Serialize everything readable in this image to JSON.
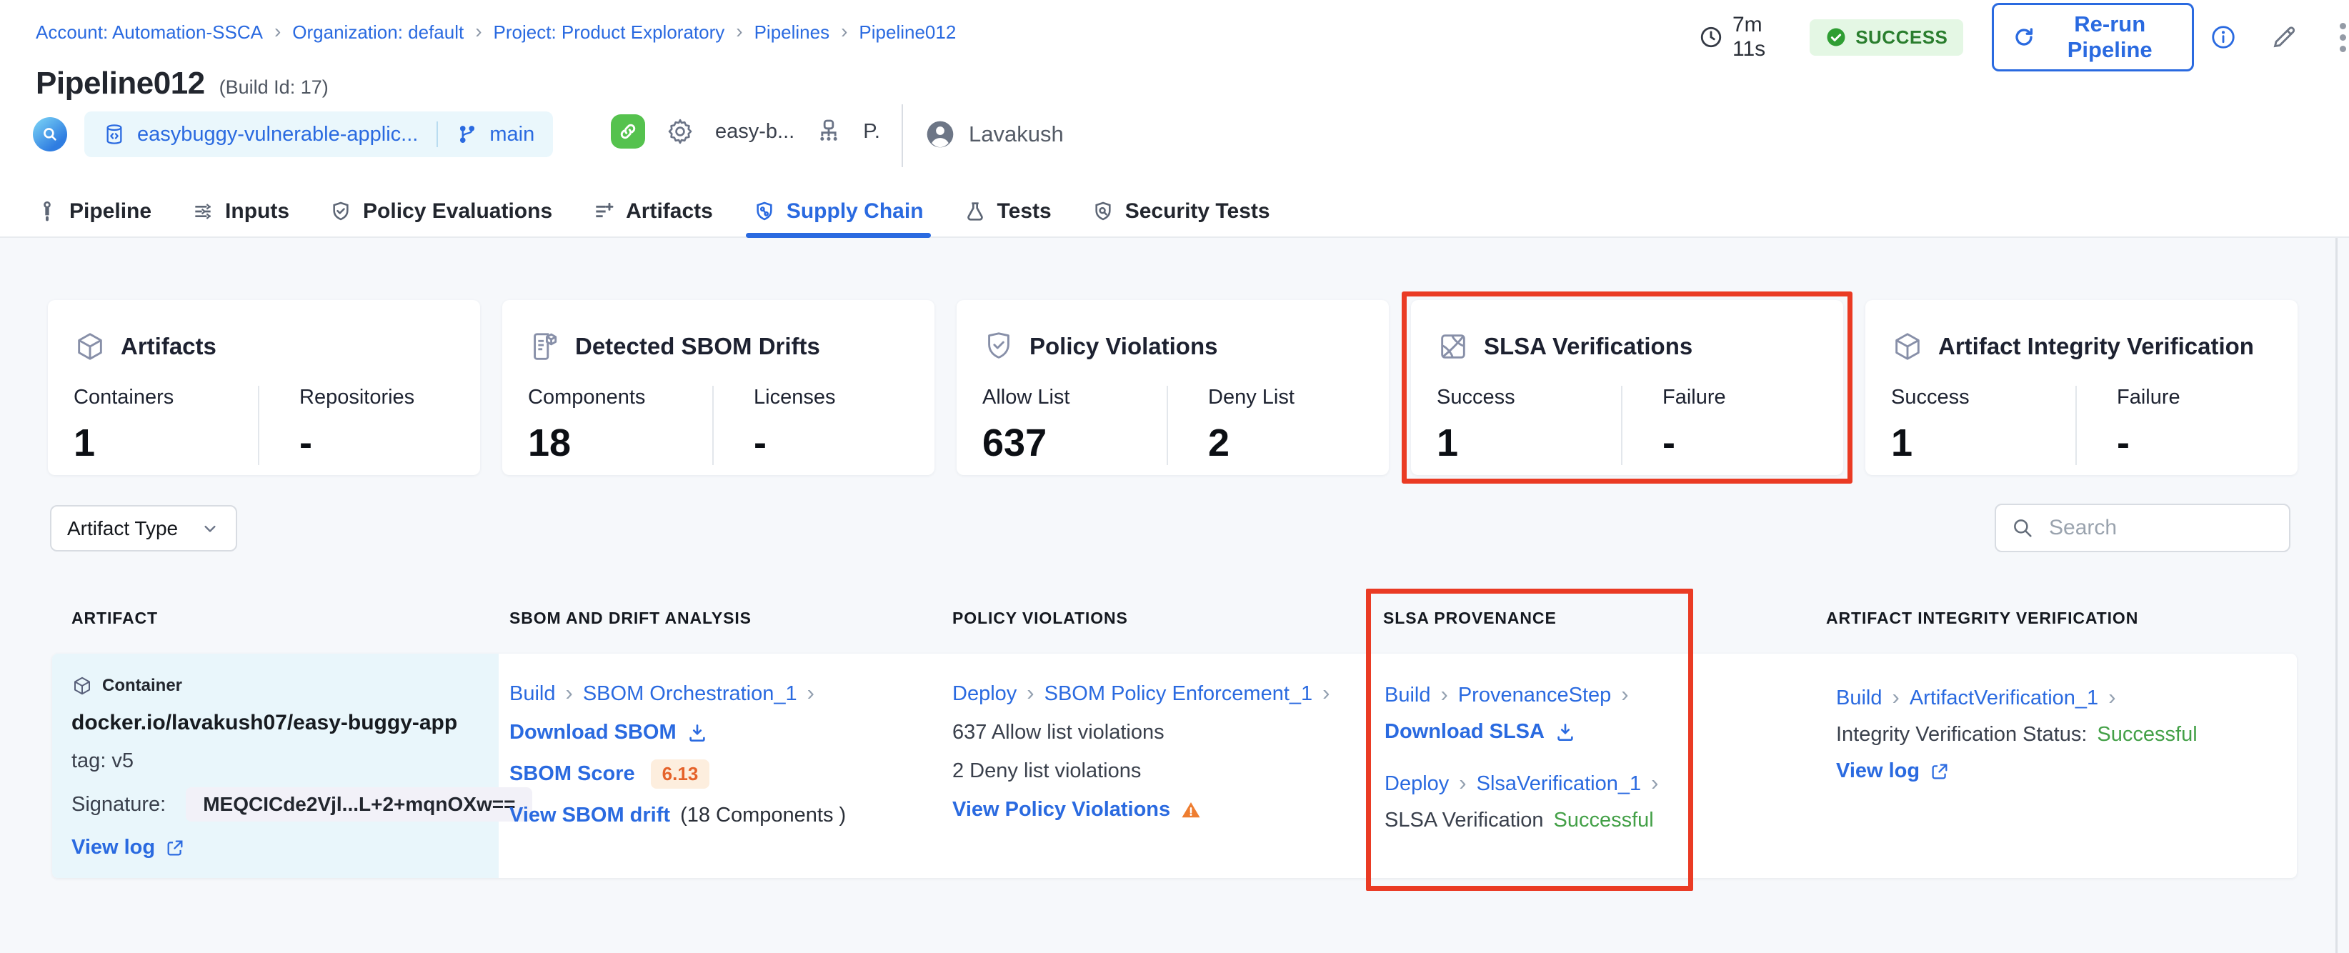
{
  "breadcrumb": {
    "items": [
      "Account: Automation-SSCA",
      "Organization: default",
      "Project: Product Exploratory",
      "Pipelines",
      "Pipeline012"
    ]
  },
  "actions": {
    "duration": "7m 11s",
    "status": "SUCCESS",
    "rerun_label": "Re-run Pipeline"
  },
  "title": {
    "name": "Pipeline012",
    "build_id": "(Build Id: 17)"
  },
  "meta": {
    "repo": "easybuggy-vulnerable-applic...",
    "branch": "main",
    "config": "easy-b...",
    "trigger": "P.",
    "user": "Lavakush"
  },
  "tabs": [
    {
      "label": "Pipeline"
    },
    {
      "label": "Inputs"
    },
    {
      "label": "Policy Evaluations"
    },
    {
      "label": "Artifacts"
    },
    {
      "label": "Supply Chain",
      "active": true
    },
    {
      "label": "Tests"
    },
    {
      "label": "Security Tests"
    }
  ],
  "cards": [
    {
      "title": "Artifacts",
      "icon": "cube-icon",
      "metrics": [
        {
          "label": "Containers",
          "value": "1"
        },
        {
          "label": "Repositories",
          "value": "-"
        }
      ]
    },
    {
      "title": "Detected SBOM Drifts",
      "icon": "sbom-document-icon",
      "metrics": [
        {
          "label": "Components",
          "value": "18"
        },
        {
          "label": "Licenses",
          "value": "-"
        }
      ]
    },
    {
      "title": "Policy Violations",
      "icon": "shield-check-icon",
      "metrics": [
        {
          "label": "Allow List",
          "value": "637"
        },
        {
          "label": "Deny List",
          "value": "2"
        }
      ]
    },
    {
      "title": "SLSA Verifications",
      "icon": "slsa-badge-icon",
      "highlighted": true,
      "metrics": [
        {
          "label": "Success",
          "value": "1"
        },
        {
          "label": "Failure",
          "value": "-"
        }
      ]
    },
    {
      "title": "Artifact Integrity Verification",
      "icon": "cube-icon",
      "metrics": [
        {
          "label": "Success",
          "value": "1"
        },
        {
          "label": "Failure",
          "value": "-"
        }
      ]
    }
  ],
  "filters": {
    "artifact_type_label": "Artifact Type",
    "search_placeholder": "Search"
  },
  "table": {
    "headers": [
      "ARTIFACT",
      "SBOM AND DRIFT ANALYSIS",
      "POLICY VIOLATIONS",
      "SLSA PROVENANCE",
      "ARTIFACT INTEGRITY VERIFICATION"
    ],
    "row": {
      "artifact": {
        "type": "Container",
        "name": "docker.io/lavakush07/easy-buggy-app",
        "tag": "tag: v5",
        "signature_label": "Signature:",
        "signature": "MEQCICde2Vjl...L+2+mqnOXw==",
        "view_log": "View log"
      },
      "sbom": {
        "stage": "Build",
        "step": "SBOM Orchestration_1",
        "download": "Download SBOM",
        "score_label": "SBOM Score",
        "score": "6.13",
        "drift_link": "View SBOM drift",
        "drift_note": "(18 Components )"
      },
      "policy": {
        "stage": "Deploy",
        "step": "SBOM Policy Enforcement_1",
        "allow": "637 Allow list violations",
        "deny": "2 Deny list violations",
        "view": "View Policy Violations"
      },
      "slsa": {
        "stage1": "Build",
        "step1": "ProvenanceStep",
        "download": "Download SLSA",
        "stage2": "Deploy",
        "step2": "SlsaVerification_1",
        "status_label": "SLSA Verification",
        "status": "Successful"
      },
      "integrity": {
        "stage": "Build",
        "step": "ArtifactVerification_1",
        "status_label": "Integrity Verification Status:",
        "status": "Successful",
        "view_log": "View log"
      }
    }
  },
  "colors": {
    "accent_blue": "#2a6ae0",
    "highlight_red": "#ea3b24",
    "success_green": "#43a047",
    "badge_green_bg": "#e4f7e4",
    "warn_orange": "#e5622a"
  }
}
